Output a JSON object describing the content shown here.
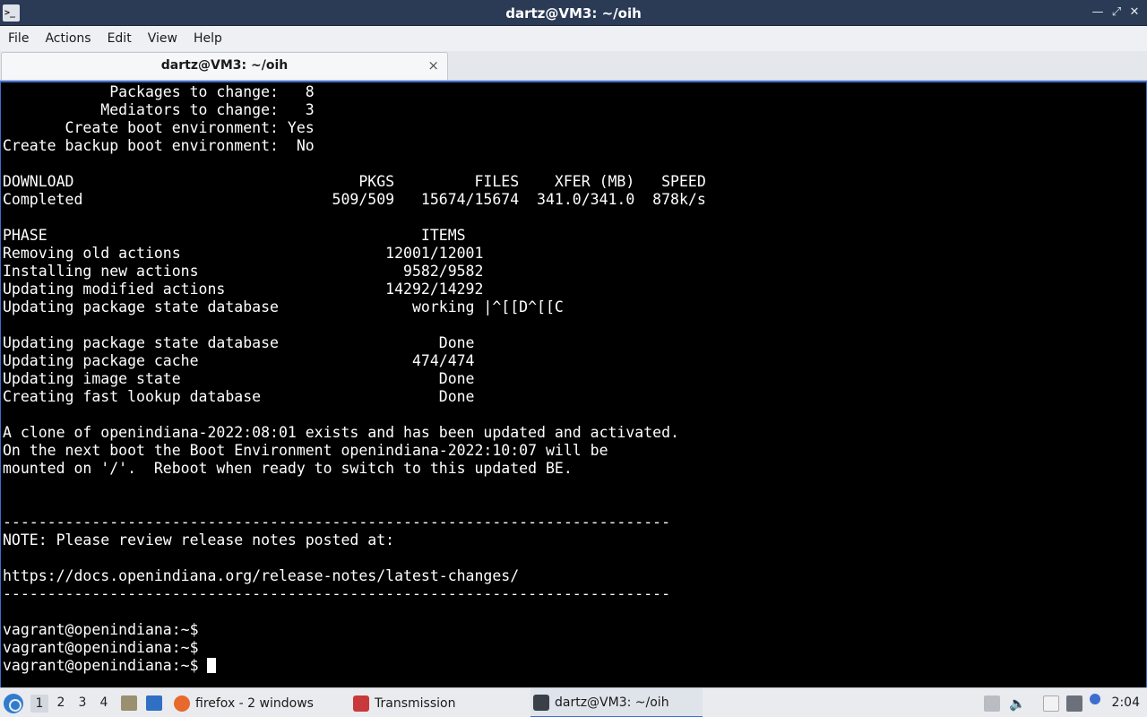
{
  "window": {
    "title": "dartz@VM3: ~/oih",
    "icon": "terminal-icon",
    "controls": [
      "minimize-icon",
      "restore-icon",
      "close-icon"
    ]
  },
  "menu": [
    "File",
    "Actions",
    "Edit",
    "View",
    "Help"
  ],
  "tab": {
    "label": "dartz@VM3: ~/oih",
    "close": "×"
  },
  "terminal": {
    "lines": [
      "            Packages to change:   8",
      "           Mediators to change:   3",
      "       Create boot environment: Yes",
      "Create backup boot environment:  No",
      "",
      "DOWNLOAD                                PKGS         FILES    XFER (MB)   SPEED",
      "Completed                            509/509   15674/15674  341.0/341.0  878k/s",
      "",
      "PHASE                                          ITEMS",
      "Removing old actions                       12001/12001",
      "Installing new actions                       9582/9582",
      "Updating modified actions                  14292/14292",
      "Updating package state database               working |^[[D^[[C",
      "",
      "Updating package state database                  Done",
      "Updating package cache                        474/474",
      "Updating image state                             Done",
      "Creating fast lookup database                    Done",
      "",
      "A clone of openindiana-2022:08:01 exists and has been updated and activated.",
      "On the next boot the Boot Environment openindiana-2022:10:07 will be",
      "mounted on '/'.  Reboot when ready to switch to this updated BE.",
      "",
      "",
      "---------------------------------------------------------------------------",
      "NOTE: Please review release notes posted at:",
      "",
      "https://docs.openindiana.org/release-notes/latest-changes/",
      "---------------------------------------------------------------------------",
      "",
      "vagrant@openindiana:~$",
      "vagrant@openindiana:~$",
      "vagrant@openindiana:~$ "
    ]
  },
  "taskbar": {
    "workspaces": [
      "1",
      "2",
      "3",
      "4"
    ],
    "active_workspace": "1",
    "tasks": [
      {
        "label": "firefox - 2 windows",
        "icon": "firefox-icon",
        "color": "#e8692c"
      },
      {
        "label": "Transmission",
        "icon": "transmission-icon",
        "color": "#c8393b"
      },
      {
        "label": "dartz@VM3: ~/oih",
        "icon": "terminal-icon",
        "color": "#3a3f48"
      }
    ],
    "clock": "2:04"
  },
  "colors": {
    "titlebar": "#2b3a55",
    "accent": "#3c6ed0",
    "terminal_bg": "#000000",
    "terminal_fg": "#ffffff"
  }
}
